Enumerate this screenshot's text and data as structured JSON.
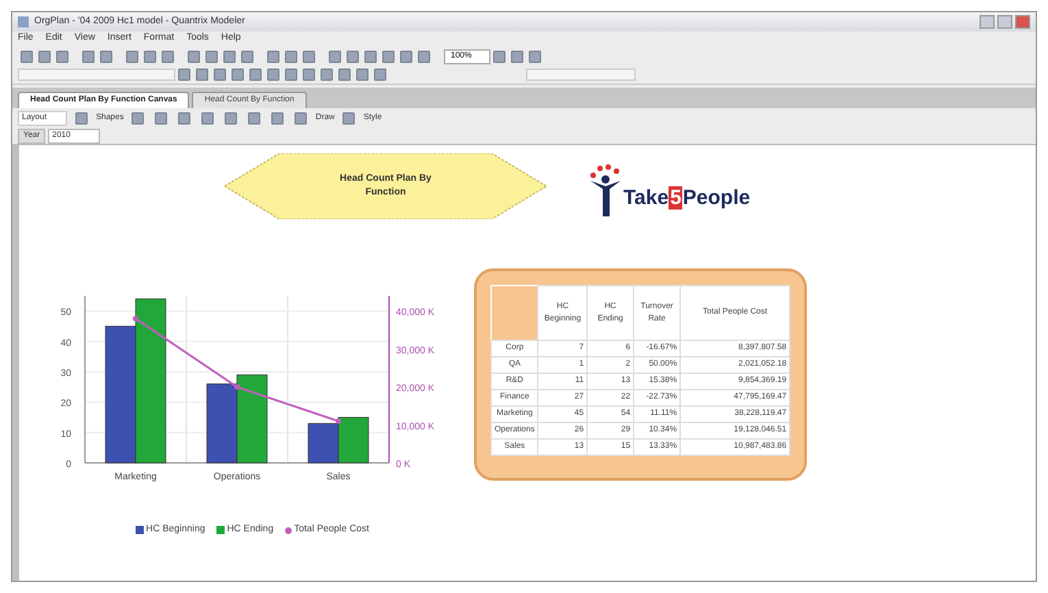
{
  "window": {
    "title": "OrgPlan - '04 2009 Hc1 model - Quantrix Modeler"
  },
  "menu": [
    "File",
    "Edit",
    "View",
    "Insert",
    "Format",
    "Tools",
    "Help"
  ],
  "toolbar": {
    "zoom": "100%"
  },
  "tabs": [
    {
      "label": "Head Count Plan By Function Canvas",
      "selected": true
    },
    {
      "label": "Head Count By Function",
      "selected": false
    }
  ],
  "canvas_toolbar": {
    "layout": "Layout",
    "shapes": "Shapes",
    "draw": "Draw",
    "style": "Style"
  },
  "filter": {
    "label": "Year",
    "value": "2010"
  },
  "diamond": {
    "text": "Head Count Plan By Function"
  },
  "logo": {
    "parts": [
      "Take",
      "5",
      "People"
    ]
  },
  "chart": {
    "chart_data": {
      "type": "bar",
      "categories": [
        "Marketing",
        "Operations",
        "Sales"
      ],
      "series": [
        {
          "name": "HC Beginning",
          "color": "#3f51b0",
          "values": [
            45,
            26,
            13
          ]
        },
        {
          "name": "HC Ending",
          "color": "#22a83a",
          "values": [
            54,
            29,
            15
          ]
        }
      ],
      "ylim": [
        0,
        55
      ],
      "yticks": [
        0,
        10,
        20,
        30,
        40,
        50
      ],
      "grid": true,
      "legend": "bottom"
    },
    "cost_chart": {
      "chart_data": {
        "type": "line",
        "series": [
          {
            "name": "Total People Cost",
            "color": "#c060c0",
            "values": [
              38000,
              20000,
              11000
            ],
            "marker": "circle"
          }
        ],
        "ylim": [
          0,
          44000
        ],
        "yticks": [
          {
            "value": 0,
            "label": "0 K"
          },
          {
            "value": 10000,
            "label": "10,000 K"
          },
          {
            "value": 20000,
            "label": "20,000 K"
          },
          {
            "value": 30000,
            "label": "30,000 K"
          },
          {
            "value": 40000,
            "label": "40,000 K"
          }
        ]
      }
    }
  },
  "table": {
    "columns": [
      "HC Beginning",
      "HC Ending",
      "Turnover Rate",
      "Total People Cost"
    ],
    "rows": [
      {
        "label": "Corp",
        "cells": [
          "7",
          "6",
          "-16.67%",
          "8,397,807.58"
        ]
      },
      {
        "label": "QA",
        "cells": [
          "1",
          "2",
          "50.00%",
          "2,021,052.18"
        ]
      },
      {
        "label": "R&D",
        "cells": [
          "11",
          "13",
          "15.38%",
          "9,854,369.19"
        ]
      },
      {
        "label": "Finance",
        "cells": [
          "27",
          "22",
          "-22.73%",
          "47,795,169.47"
        ]
      },
      {
        "label": "Marketing",
        "cells": [
          "45",
          "54",
          "11.11%",
          "38,228,119.47"
        ]
      },
      {
        "label": "Operations",
        "cells": [
          "26",
          "29",
          "10.34%",
          "19,128,046.51"
        ]
      },
      {
        "label": "Sales",
        "cells": [
          "13",
          "15",
          "13.33%",
          "10,987,483.86"
        ]
      }
    ]
  }
}
